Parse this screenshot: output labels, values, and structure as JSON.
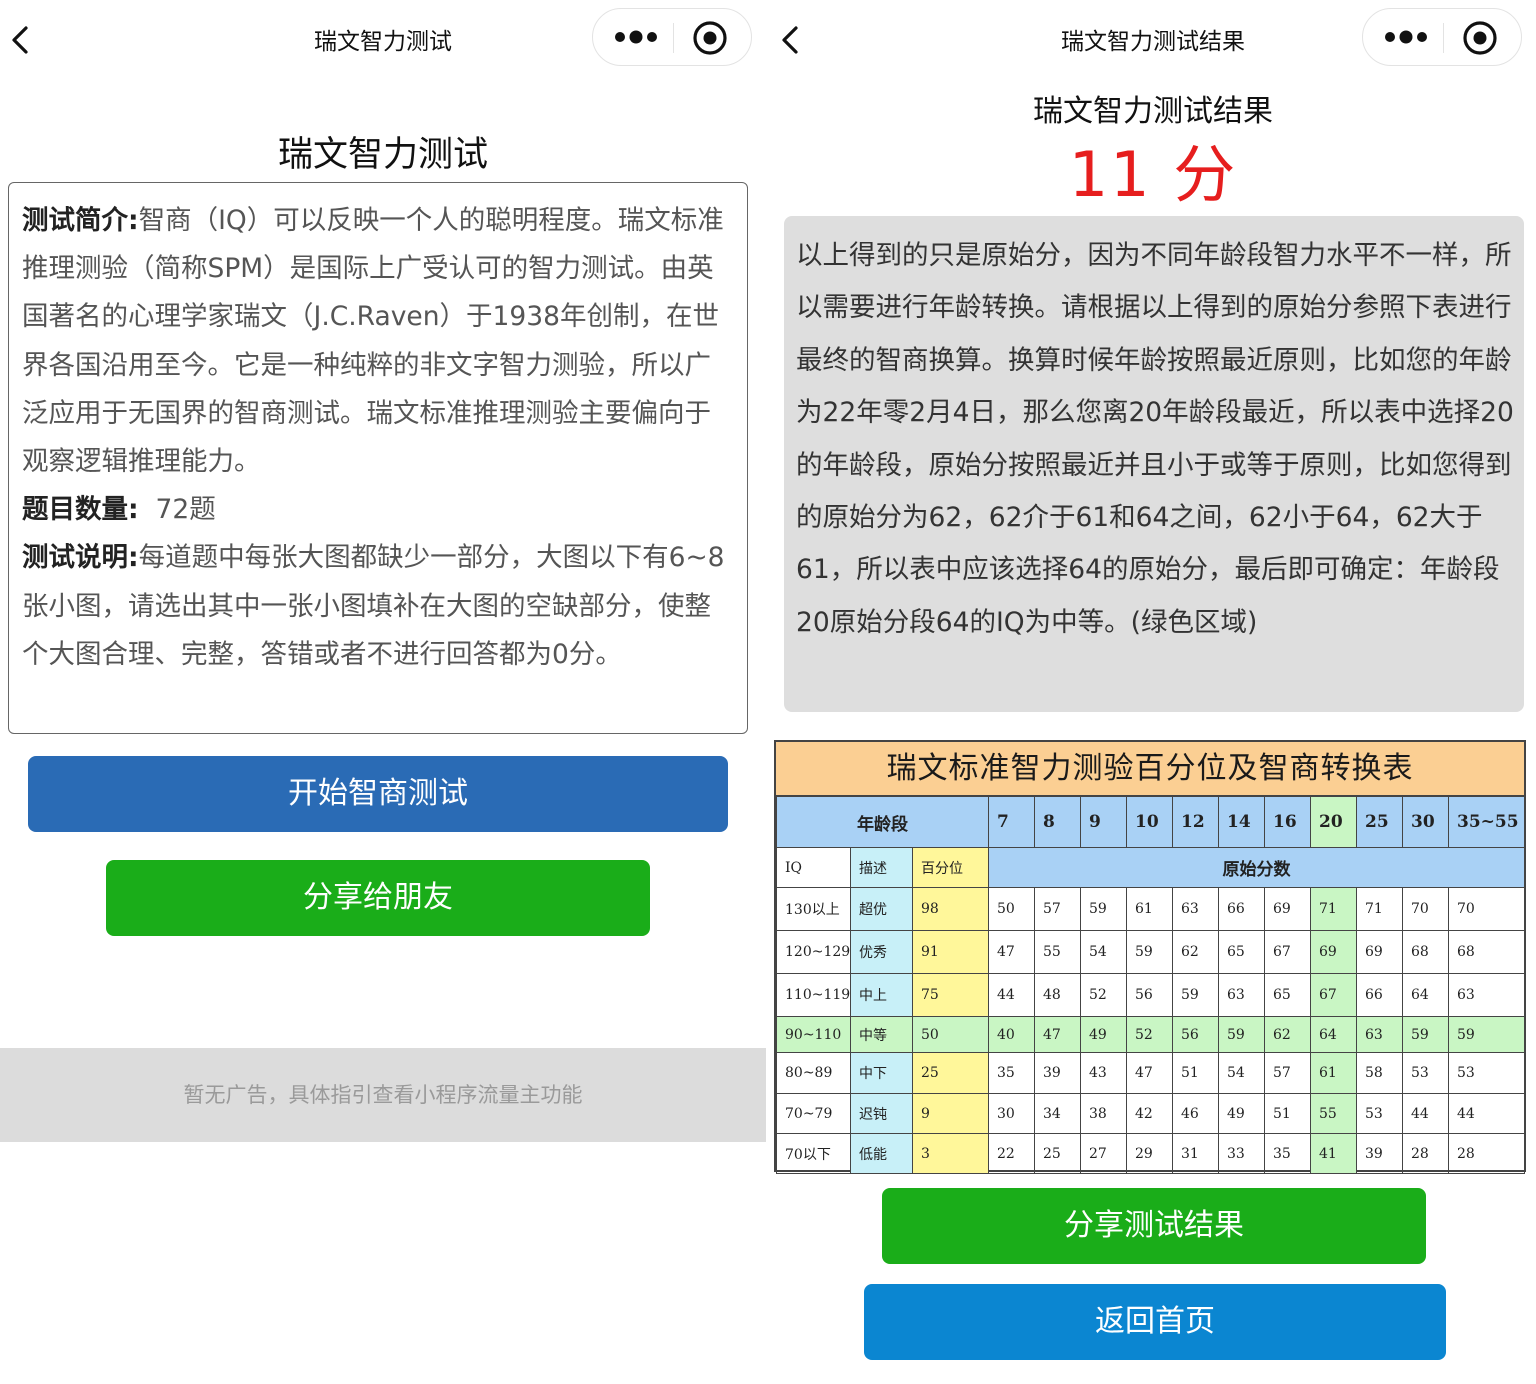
{
  "left": {
    "nav_title": "瑞文智力测试",
    "page_title": "瑞文智力测试",
    "intro_label": "测试简介:",
    "intro_text": "智商（IQ）可以反映一个人的聪明程度。瑞文标准推理测验（简称SPM）是国际上广受认可的智力测试。由英国著名的心理学家瑞文（J.C.Raven）于1938年创制，在世界各国沿用至今。它是一种纯粹的非文字智力测验，所以广泛应用于无国界的智商测试。瑞文标准推理测验主要偏向于观察逻辑推理能力。",
    "count_label": "题目数量:",
    "count_text": "72题",
    "desc_label": "测试说明:",
    "desc_text": "每道题中每张大图都缺少一部分，大图以下有6~8张小图，请选出其中一张小图填补在大图的空缺部分，使整个大图合理、完整，答错或者不进行回答都为0分。",
    "start_button": "开始智商测试",
    "share_button": "分享给朋友",
    "ad_text": "暂无广告，具体指引查看小程序流量主功能"
  },
  "right": {
    "nav_title": "瑞文智力测试结果",
    "result_title": "瑞文智力测试结果",
    "score": "11 分",
    "explain_text": "以上得到的只是原始分，因为不同年龄段智力水平不一样，所以需要进行年龄转换。请根据以上得到的原始分参照下表进行最终的智商换算。换算时候年龄按照最近原则，比如您的年龄为22年零2月4日，那么您离20年龄段最近，所以表中选择20的年龄段，原始分按照最近并且小于或等于原则，比如您得到的原始分为62，62介于61和64之间，62小于64，62大于61，所以表中应该选择64的原始分，最后即可确定：年龄段20原始分段64的IQ为中等。(绿色区域)",
    "share_result_button": "分享测试结果",
    "home_button": "返回首页"
  },
  "iq_table": {
    "title": "瑞文标准智力测验百分位及智商转换表",
    "age_label": "年龄段",
    "ages": [
      "7",
      "8",
      "9",
      "10",
      "12",
      "14",
      "16",
      "20",
      "25",
      "30",
      "35~55"
    ],
    "col_iq": "IQ",
    "col_desc": "描述",
    "col_pct": "百分位",
    "raw_label": "原始分数",
    "rows": [
      {
        "iq": "130以上",
        "desc": "超优",
        "pct": "98",
        "scores": [
          "50",
          "57",
          "59",
          "61",
          "63",
          "66",
          "69",
          "71",
          "71",
          "70",
          "70"
        ]
      },
      {
        "iq": "120~129",
        "desc": "优秀",
        "pct": "91",
        "scores": [
          "47",
          "55",
          "54",
          "59",
          "62",
          "65",
          "67",
          "69",
          "69",
          "68",
          "68"
        ]
      },
      {
        "iq": "110~119",
        "desc": "中上",
        "pct": "75",
        "scores": [
          "44",
          "48",
          "52",
          "56",
          "59",
          "63",
          "65",
          "67",
          "66",
          "64",
          "63"
        ]
      },
      {
        "iq": "90~110",
        "desc": "中等",
        "pct": "50",
        "scores": [
          "40",
          "47",
          "49",
          "52",
          "56",
          "59",
          "62",
          "64",
          "63",
          "59",
          "59"
        ]
      },
      {
        "iq": "80~89",
        "desc": "中下",
        "pct": "25",
        "scores": [
          "35",
          "39",
          "43",
          "47",
          "51",
          "54",
          "57",
          "61",
          "58",
          "53",
          "53"
        ]
      },
      {
        "iq": "70~79",
        "desc": "迟钝",
        "pct": "9",
        "scores": [
          "30",
          "34",
          "38",
          "42",
          "46",
          "49",
          "51",
          "55",
          "53",
          "44",
          "44"
        ]
      },
      {
        "iq": "70以下",
        "desc": "低能",
        "pct": "3",
        "scores": [
          "22",
          "25",
          "27",
          "29",
          "31",
          "33",
          "35",
          "41",
          "39",
          "28",
          "28"
        ]
      }
    ],
    "highlight_row": 3,
    "highlight_col": 7
  },
  "colors": {
    "start_button": "#2a6bb5",
    "share_button": "#1aad19",
    "home_button": "#0b86d1",
    "score": "#e61e1e",
    "table_header": "#fbcf93",
    "table_age_row": "#a9d1f5",
    "table_desc_col": "#c8f0f8",
    "table_pct_col": "#fff79a",
    "table_highlight": "#c9f6c4"
  },
  "icons": [
    "back-arrow-icon",
    "more-dots-icon",
    "close-circle-icon"
  ]
}
